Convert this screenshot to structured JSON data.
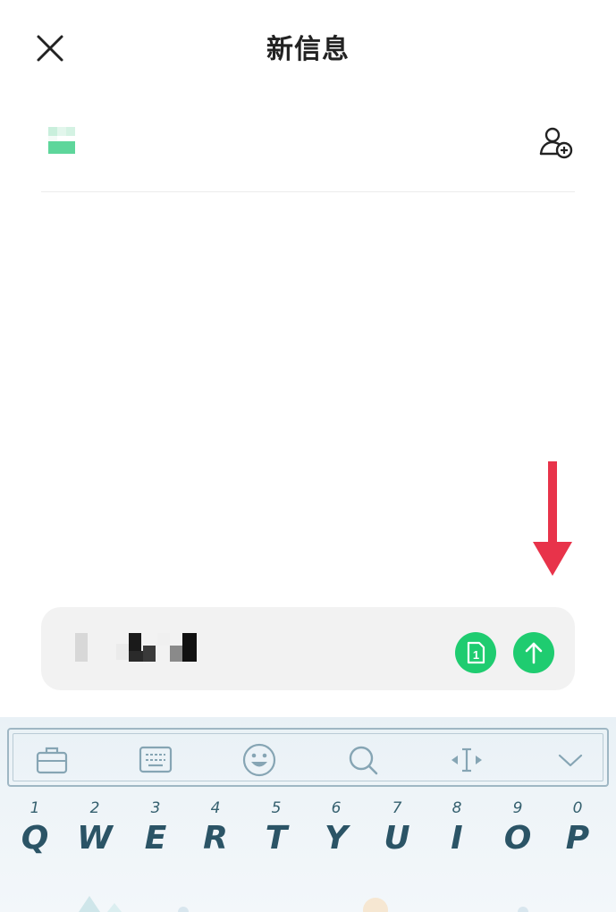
{
  "header": {
    "title": "新信息",
    "close_icon": "close-icon"
  },
  "recipient": {
    "avatar_icon": "recipient-avatar-icon",
    "add_contact_icon": "add-contact-icon"
  },
  "composer": {
    "text": "",
    "sim_label": "1",
    "sim_icon": "sim-card-icon",
    "send_icon": "send-arrow-icon"
  },
  "keyboard": {
    "toolbar": [
      "toolbox-icon",
      "keyboard-layout-icon",
      "emoji-icon",
      "search-icon",
      "cursor-move-icon",
      "collapse-keyboard-icon"
    ],
    "keys": [
      {
        "num": "1",
        "letter": "Q"
      },
      {
        "num": "2",
        "letter": "W"
      },
      {
        "num": "3",
        "letter": "E"
      },
      {
        "num": "4",
        "letter": "R"
      },
      {
        "num": "5",
        "letter": "T"
      },
      {
        "num": "6",
        "letter": "Y"
      },
      {
        "num": "7",
        "letter": "U"
      },
      {
        "num": "8",
        "letter": "I"
      },
      {
        "num": "9",
        "letter": "O"
      },
      {
        "num": "0",
        "letter": "P"
      }
    ]
  },
  "colors": {
    "accent_green": "#1fcc70",
    "annotation_red": "#e8334a",
    "keyboard_text": "#2b5466"
  }
}
